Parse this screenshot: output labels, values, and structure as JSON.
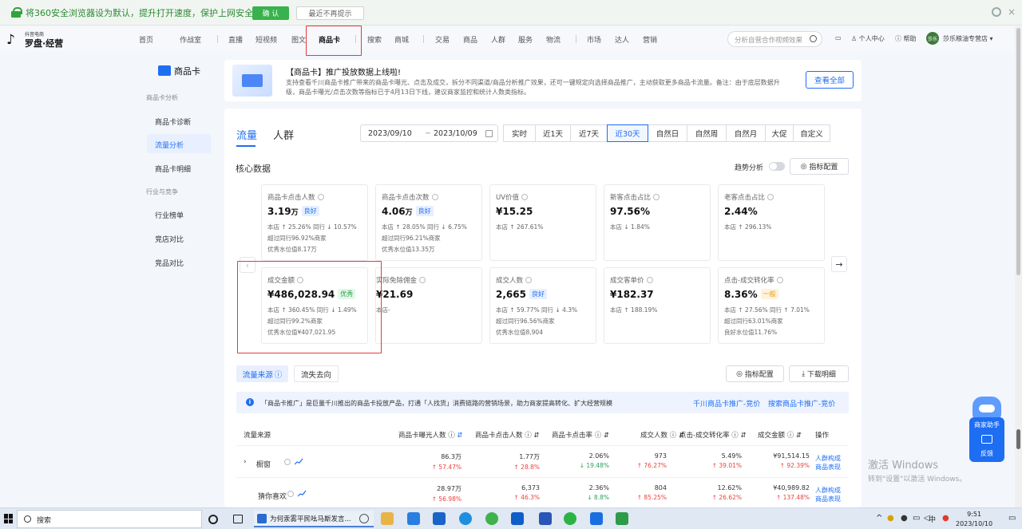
{
  "browser_bar": {
    "message": "将360安全浏览器设为默认，提升打开速度，保护上网安全",
    "confirm_label": "确 认",
    "dismiss_label": "最近不再提示"
  },
  "logo": {
    "small": "抖音电商",
    "big": "罗盘·经营"
  },
  "nav": {
    "items": [
      "首页",
      "作战室",
      "直播",
      "短视频",
      "图文",
      "商品卡",
      "搜索",
      "商城",
      "交易",
      "商品",
      "人群",
      "服务",
      "物流",
      "市场",
      "达人",
      "营销"
    ],
    "search_placeholder": "分析自营合作视频效果",
    "personal_center": "个人中心",
    "help": "帮助",
    "avatar_text": "莎乐",
    "shop_name": "莎乐粮油专营店"
  },
  "sidebar": {
    "title": "商品卡",
    "section1": "商品卡分析",
    "items1": [
      "商品卡诊断",
      "流量分析",
      "商品卡明细"
    ],
    "section2": "行业与竞争",
    "items2": [
      "行业榜单",
      "竞店对比",
      "竞品对比"
    ]
  },
  "notice": {
    "title": "【商品卡】推广投放数据上线啦!",
    "desc": "支持查看千川商品卡推广带来的商品卡曝光、点击及成交，拆分不同渠道/商品分析推广效果，还可一键规定向选择商品推广，主动获取更多商品卡流量。备注：由于底层数据升级，商品卡曝光/点击次数等指标已于4月13日下线，建议商家监控和统计人数类指标。",
    "button": "查看全部"
  },
  "panel": {
    "tabs": [
      "流量",
      "人群"
    ],
    "date_start": "2023/09/10",
    "date_sep": "~",
    "date_end": "2023/10/09",
    "ranges": [
      "实时",
      "近1天",
      "近7天",
      "近30天",
      "自然日",
      "自然周",
      "自然月",
      "大促",
      "自定义"
    ],
    "active_range": "近30天",
    "core_title": "核心数据",
    "trend_label": "趋势分析",
    "config_label": "指标配置",
    "prev_arrow": "‹",
    "next_arrow": "→"
  },
  "cards": [
    {
      "label": "商品卡点击人数",
      "value": "3.19",
      "unit": "万",
      "badge": "良好",
      "badge_type": "good",
      "l1": "本店 ↑ 25.26% 同行 ↓ 10.57%",
      "l2": "超过同行96.92%商家",
      "l3": "优秀水位值8.17万"
    },
    {
      "label": "商品卡点击次数",
      "value": "4.06",
      "unit": "万",
      "badge": "良好",
      "badge_type": "good",
      "l1": "本店 ↑ 28.05% 同行 ↓ 6.75%",
      "l2": "超过同行96.21%商家",
      "l3": "优秀水位值13.35万"
    },
    {
      "label": "UV价值",
      "value": "¥15.25",
      "unit": "",
      "badge": "",
      "badge_type": "",
      "l1": "本店 ↑ 267.61%",
      "l2": "",
      "l3": ""
    },
    {
      "label": "新客点击占比",
      "value": "97.56%",
      "unit": "",
      "badge": "",
      "badge_type": "",
      "l1": "本店 ↓ 1.84%",
      "l2": "",
      "l3": ""
    },
    {
      "label": "老客点击占比",
      "value": "2.44%",
      "unit": "",
      "badge": "",
      "badge_type": "",
      "l1": "本店 ↑ 296.13%",
      "l2": "",
      "l3": ""
    },
    {
      "label": "成交金额",
      "value": "¥486,028.94",
      "unit": "",
      "badge": "优秀",
      "badge_type": "excellent",
      "l1": "本店 ↑ 360.45% 同行 ↓ 1.49%",
      "l2": "超过同行99.2%商家",
      "l3": "优秀水位值¥407,021.95"
    },
    {
      "label": "实际免除佣金",
      "value": "¥21.69",
      "unit": "",
      "badge": "",
      "badge_type": "",
      "l1": "本店-",
      "l2": "",
      "l3": ""
    },
    {
      "label": "成交人数",
      "value": "2,665",
      "unit": "",
      "badge": "良好",
      "badge_type": "good",
      "l1": "本店 ↑ 59.77% 同行 ↓ 4.3%",
      "l2": "超过同行96.56%商家",
      "l3": "优秀水位值8,904"
    },
    {
      "label": "成交客单价",
      "value": "¥182.37",
      "unit": "",
      "badge": "",
      "badge_type": "",
      "l1": "本店 ↑ 188.19%",
      "l2": "",
      "l3": ""
    },
    {
      "label": "点击-成交转化率",
      "value": "8.36%",
      "unit": "",
      "badge": "一般",
      "badge_type": "normal",
      "l1": "本店 ↑ 27.56% 同行 ↑ 7.01%",
      "l2": "超过同行63.01%商家",
      "l3": "良好水位值11.76%"
    }
  ],
  "source": {
    "tabs": [
      "流量来源",
      "流失去向"
    ],
    "config_label": "指标配置",
    "download_label": "下载明细",
    "info_text": "「商品卡推广」是巨量千川推出的商品卡投放产品，打通「人找货」消费链路的营销场景，助力商家提高转化、扩大经营规模",
    "link1": "千川商品卡推广-竞价",
    "link2": "搜索商品卡推广-竞价",
    "columns": [
      "流量来源",
      "商品卡曝光人数",
      "商品卡点击人数",
      "商品卡点击率",
      "成交人数",
      "点击-成交转化率",
      "成交金额",
      "操作"
    ],
    "rows": [
      {
        "name": "橱窗",
        "expandable": "›",
        "c1": "86.3万",
        "c1s": "↑ 57.47%",
        "c2": "1.77万",
        "c2s": "↑ 28.8%",
        "c3": "2.06%",
        "c3s": "↓ 19.48%",
        "c4": "973",
        "c4s": "↑ 76.27%",
        "c5": "5.49%",
        "c5s": "↑ 39.01%",
        "c6": "¥91,514.15",
        "c6s": "↑ 92.39%",
        "op1": "人群构成",
        "op2": "商品表现"
      },
      {
        "name": "猜你喜欢",
        "expandable": "",
        "c1": "28.97万",
        "c1s": "↑ 56.98%",
        "c2": "6,373",
        "c2s": "↑ 46.3%",
        "c3": "2.36%",
        "c3s": "↓ 8.8%",
        "c4": "804",
        "c4s": "↑ 85.25%",
        "c5": "12.62%",
        "c5s": "↑ 26.62%",
        "c6": "¥40,989.82",
        "c6s": "↑ 137.48%",
        "op1": "人群构成",
        "op2": "商品表现"
      }
    ]
  },
  "assistant": {
    "title": "商家助手",
    "feedback": "反馈"
  },
  "watermark": {
    "line1": "激活 Windows",
    "line2": "转到\"设置\"以激活 Windows。"
  },
  "taskbar": {
    "search": "搜索",
    "active_task": "为何汞雾平民吆马斯发言...",
    "tray_ime": "中",
    "time": "9:51",
    "date": "2023/10/10"
  }
}
